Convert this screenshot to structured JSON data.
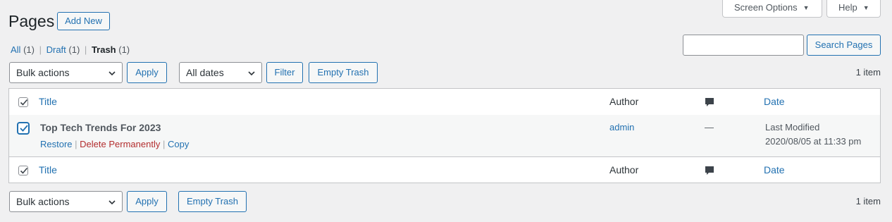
{
  "header": {
    "title": "Pages",
    "add_new_label": "Add New",
    "screen_options_label": "Screen Options",
    "help_label": "Help"
  },
  "filters": {
    "views": [
      {
        "label": "All",
        "count": "(1)"
      },
      {
        "label": "Draft",
        "count": "(1)"
      },
      {
        "label": "Trash",
        "count": "(1)"
      }
    ],
    "separator": "|"
  },
  "search": {
    "value": "",
    "button_label": "Search Pages"
  },
  "top_nav": {
    "bulk_actions": "Bulk actions",
    "apply_label": "Apply",
    "dates": "All dates",
    "filter_label": "Filter",
    "empty_trash_label": "Empty Trash",
    "item_count": "1 item"
  },
  "table": {
    "columns": {
      "title": "Title",
      "author": "Author",
      "date": "Date"
    },
    "rows": [
      {
        "title": "Top Tech Trends For 2023",
        "author": "admin",
        "comments": "—",
        "date_status": "Last Modified",
        "date_value": "2020/08/05 at 11:33 pm",
        "actions": {
          "restore": "Restore",
          "delete": "Delete Permanently",
          "copy": "Copy"
        }
      }
    ]
  },
  "bottom_nav": {
    "bulk_actions": "Bulk actions",
    "apply_label": "Apply",
    "empty_trash_label": "Empty Trash",
    "item_count": "1 item"
  },
  "colors": {
    "link": "#2271b1",
    "delete": "#b32d2e",
    "text": "#3c434a",
    "background": "#f0f0f1"
  }
}
